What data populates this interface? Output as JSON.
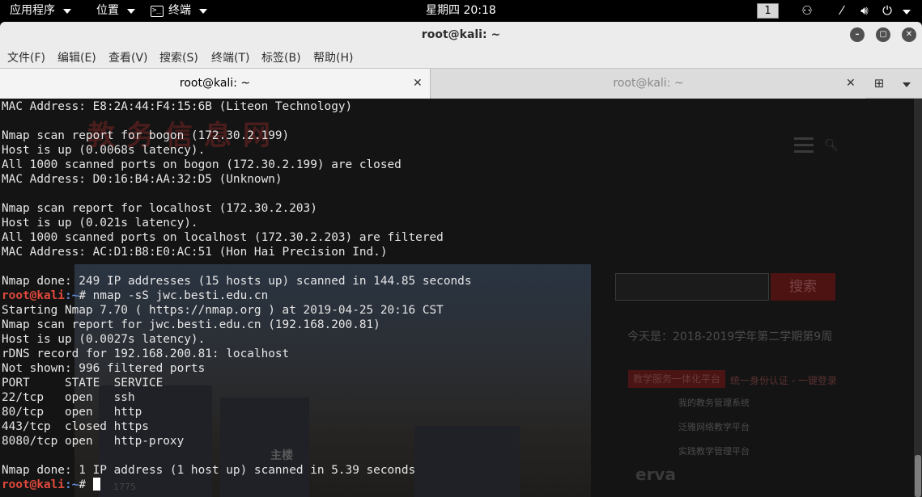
{
  "topbar": {
    "apps_menu": "应用程序",
    "places_menu": "位置",
    "terminal_menu": "终端",
    "clock": "星期四 20:18",
    "workspace": "1"
  },
  "window": {
    "title": "root@kali: ~"
  },
  "menubar": {
    "items": [
      "文件(F)",
      "编辑(E)",
      "查看(V)",
      "搜索(S)",
      "终端(T)",
      "标签(B)",
      "帮助(H)"
    ]
  },
  "tabs": [
    {
      "label": "root@kali: ~",
      "active": true
    },
    {
      "label": "root@kali: ~",
      "active": false
    }
  ],
  "background_page": {
    "banner": "教务信息网",
    "search_button": "搜索",
    "date_text": "今天是：2018-2019学年第二学期第9周",
    "platform_tag": "教学服务一体化平台",
    "auth_text": "统一身份认证 - 一键登录",
    "links": [
      "我的教务管理系统",
      "泛雅网络教学平台",
      "实践教学管理平台"
    ],
    "photo_caption": "主楼",
    "logo_text": "erva",
    "counter": "1775"
  },
  "terminal": {
    "prompt_user": "root@kali",
    "prompt_path": ":~# ",
    "lines": [
      {
        "type": "out",
        "text": "MAC Address: E8:2A:44:F4:15:6B (Liteon Technology)"
      },
      {
        "type": "out",
        "text": ""
      },
      {
        "type": "out",
        "text": "Nmap scan report for bogon (172.30.2.199)"
      },
      {
        "type": "out",
        "text": "Host is up (0.0068s latency)."
      },
      {
        "type": "out",
        "text": "All 1000 scanned ports on bogon (172.30.2.199) are closed"
      },
      {
        "type": "out",
        "text": "MAC Address: D0:16:B4:AA:32:D5 (Unknown)"
      },
      {
        "type": "out",
        "text": ""
      },
      {
        "type": "out",
        "text": "Nmap scan report for localhost (172.30.2.203)"
      },
      {
        "type": "out",
        "text": "Host is up (0.021s latency)."
      },
      {
        "type": "out",
        "text": "All 1000 scanned ports on localhost (172.30.2.203) are filtered"
      },
      {
        "type": "out",
        "text": "MAC Address: AC:D1:B8:E0:AC:51 (Hon Hai Precision Ind.)"
      },
      {
        "type": "out",
        "text": ""
      },
      {
        "type": "out",
        "text": "Nmap done: 249 IP addresses (15 hosts up) scanned in 144.85 seconds"
      },
      {
        "type": "cmd",
        "text": "nmap -sS jwc.besti.edu.cn"
      },
      {
        "type": "out",
        "text": "Starting Nmap 7.70 ( https://nmap.org ) at 2019-04-25 20:16 CST"
      },
      {
        "type": "out",
        "text": "Nmap scan report for jwc.besti.edu.cn (192.168.200.81)"
      },
      {
        "type": "out",
        "text": "Host is up (0.0027s latency)."
      },
      {
        "type": "out",
        "text": "rDNS record for 192.168.200.81: localhost"
      },
      {
        "type": "out",
        "text": "Not shown: 996 filtered ports"
      },
      {
        "type": "out",
        "text": "PORT     STATE  SERVICE"
      },
      {
        "type": "out",
        "text": "22/tcp   open   ssh"
      },
      {
        "type": "out",
        "text": "80/tcp   open   http"
      },
      {
        "type": "out",
        "text": "443/tcp  closed https"
      },
      {
        "type": "out",
        "text": "8080/tcp open   http-proxy"
      },
      {
        "type": "out",
        "text": ""
      },
      {
        "type": "out",
        "text": "Nmap done: 1 IP address (1 host up) scanned in 5.39 seconds"
      },
      {
        "type": "cmd",
        "text": "",
        "cursor": true
      }
    ]
  },
  "colors": {
    "prompt_user": "#e0493d",
    "prompt_path": "#5d8dd8",
    "terminal_bg": "#141414",
    "terminal_fg": "#e6e6e6"
  }
}
